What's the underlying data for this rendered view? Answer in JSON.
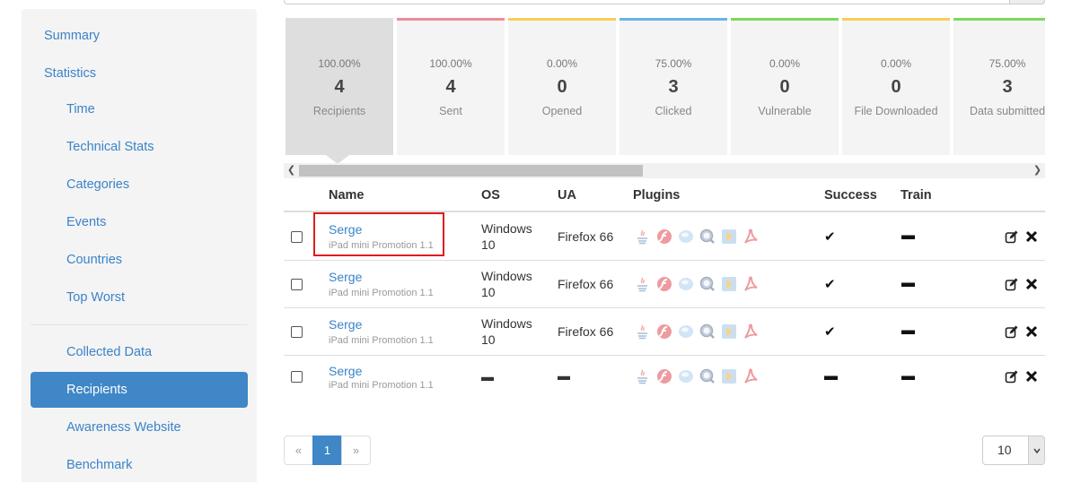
{
  "sidebar": {
    "items": [
      {
        "label": "Summary"
      },
      {
        "label": "Statistics"
      },
      {
        "label": "Time"
      },
      {
        "label": "Technical Stats"
      },
      {
        "label": "Categories"
      },
      {
        "label": "Events"
      },
      {
        "label": "Countries"
      },
      {
        "label": "Top Worst"
      },
      {
        "label": "Collected Data"
      },
      {
        "label": "Recipients"
      },
      {
        "label": "Awareness Website"
      },
      {
        "label": "Benchmark"
      }
    ]
  },
  "stats": {
    "cards": [
      {
        "percent": "100.00%",
        "count": "4",
        "label": "Recipients",
        "color": "#dedede"
      },
      {
        "percent": "100.00%",
        "count": "4",
        "label": "Sent",
        "color": "#f08b9a"
      },
      {
        "percent": "0.00%",
        "count": "0",
        "label": "Opened",
        "color": "#f5cf5a"
      },
      {
        "percent": "75.00%",
        "count": "3",
        "label": "Clicked",
        "color": "#6cb2e8"
      },
      {
        "percent": "0.00%",
        "count": "0",
        "label": "Vulnerable",
        "color": "#7fd858"
      },
      {
        "percent": "0.00%",
        "count": "0",
        "label": "File Downloaded",
        "color": "#f5cf5a"
      },
      {
        "percent": "75.00%",
        "count": "3",
        "label": "Data submitted",
        "color": "#7fd858"
      }
    ]
  },
  "table": {
    "headers": {
      "name": "Name",
      "os": "OS",
      "ua": "UA",
      "plugins": "Plugins",
      "success": "Success",
      "train": "Train"
    },
    "rows": [
      {
        "name": "Serge",
        "campaign": "iPad mini Promotion 1.1",
        "os_line1": "Windows",
        "os_line2": "10",
        "ua": "Firefox 66",
        "success": "✔",
        "train": "▬"
      },
      {
        "name": "Serge",
        "campaign": "iPad mini Promotion 1.1",
        "os_line1": "Windows",
        "os_line2": "10",
        "ua": "Firefox 66",
        "success": "✔",
        "train": "▬"
      },
      {
        "name": "Serge",
        "campaign": "iPad mini Promotion 1.1",
        "os_line1": "Windows",
        "os_line2": "10",
        "ua": "Firefox 66",
        "success": "✔",
        "train": "▬"
      },
      {
        "name": "Serge",
        "campaign": "iPad mini Promotion 1.1",
        "os_line1": "▬",
        "os_line2": "",
        "ua": "▬",
        "success": "▬",
        "train": "▬"
      }
    ],
    "plugin_icons": [
      "java-icon",
      "flash-icon",
      "silverlight-icon",
      "quicktime-icon",
      "windows-media-icon",
      "acrobat-icon"
    ]
  },
  "pagination": {
    "prev": "«",
    "current": "1",
    "next": "»"
  },
  "page_size": "10"
}
